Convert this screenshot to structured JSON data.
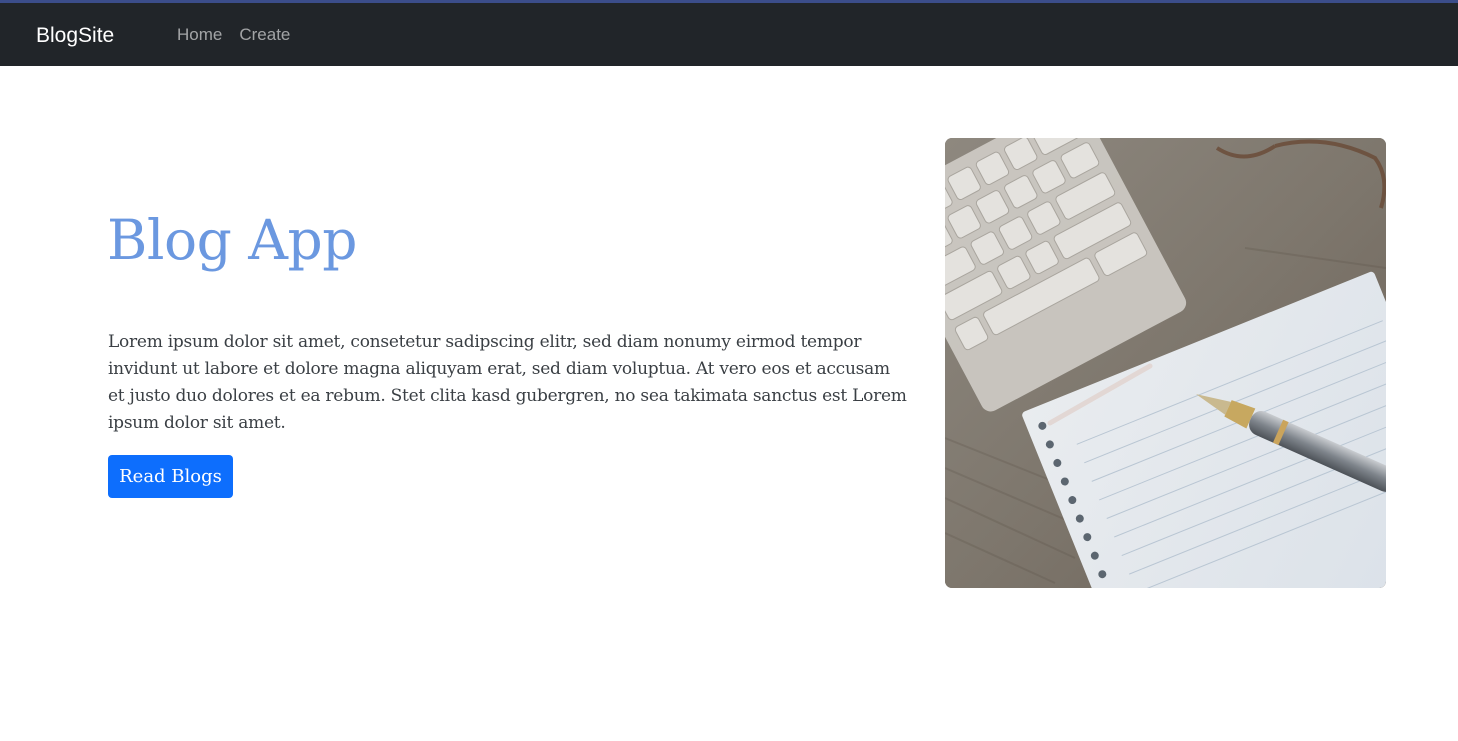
{
  "navbar": {
    "brand": "BlogSite",
    "links": [
      {
        "label": "Home"
      },
      {
        "label": "Create"
      }
    ]
  },
  "hero": {
    "title": "Blog App",
    "description": "Lorem ipsum dolor sit amet, consetetur sadipscing elitr, sed diam nonumy eirmod tempor invidunt ut labore et dolore magna aliquyam erat, sed diam voluptua. At vero eos et accusam et justo duo dolores et ea rebum. Stet clita kasd gubergren, no sea takimata sanctus est Lorem ipsum dolor sit amet.",
    "button_label": "Read Blogs",
    "image_icon": "desk-notebook-pen-photo"
  },
  "colors": {
    "navbar_bg": "#212529",
    "title": "#6b98e0",
    "primary_button": "#0d6efd"
  }
}
